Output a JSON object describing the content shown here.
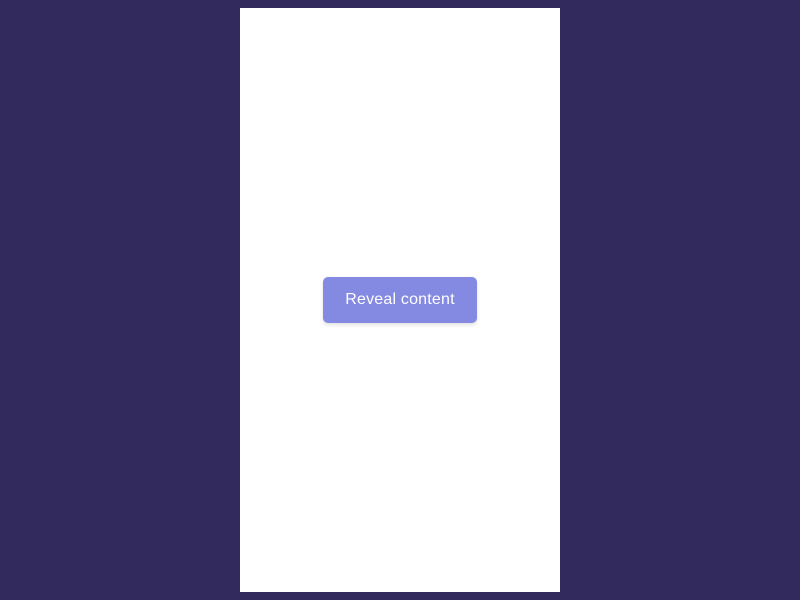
{
  "button": {
    "label": "Reveal content"
  },
  "colors": {
    "background": "#322a5c",
    "panel": "#ffffff",
    "button_bg": "#8489e2",
    "button_text": "#ffffff"
  }
}
